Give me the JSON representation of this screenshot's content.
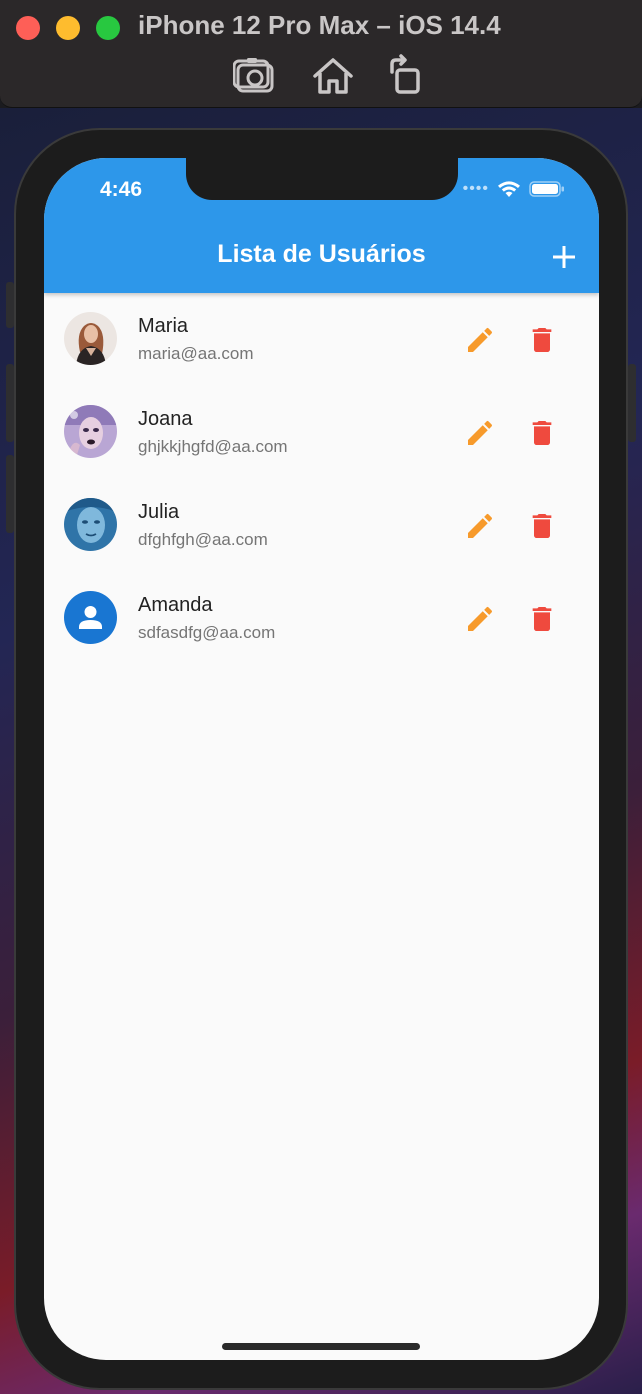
{
  "window": {
    "title": "iPhone 12 Pro Max – iOS 14.4",
    "toolbar_icons": [
      "screenshot-icon",
      "home-icon",
      "rotate-icon"
    ]
  },
  "status_bar": {
    "time": "4:46",
    "icons": [
      "signal-dots-icon",
      "wifi-icon",
      "battery-icon"
    ]
  },
  "app_bar": {
    "title": "Lista de Usuários",
    "action_icon": "add-icon",
    "color": "#2d97ea"
  },
  "users": [
    {
      "name": "Maria",
      "email": "maria@aa.com",
      "avatar": "photo-portrait"
    },
    {
      "name": "Joana",
      "email": "ghjkkjhgfd@aa.com",
      "avatar": "photo-portrait"
    },
    {
      "name": "Julia",
      "email": "dfghfgh@aa.com",
      "avatar": "photo-portrait"
    },
    {
      "name": "Amanda",
      "email": "sdfasdfg@aa.com",
      "avatar": "person-icon"
    }
  ],
  "actions": {
    "edit_icon": "pencil-icon",
    "edit_color": "#f79a2b",
    "delete_icon": "trash-icon",
    "delete_color": "#ef4a3e"
  }
}
